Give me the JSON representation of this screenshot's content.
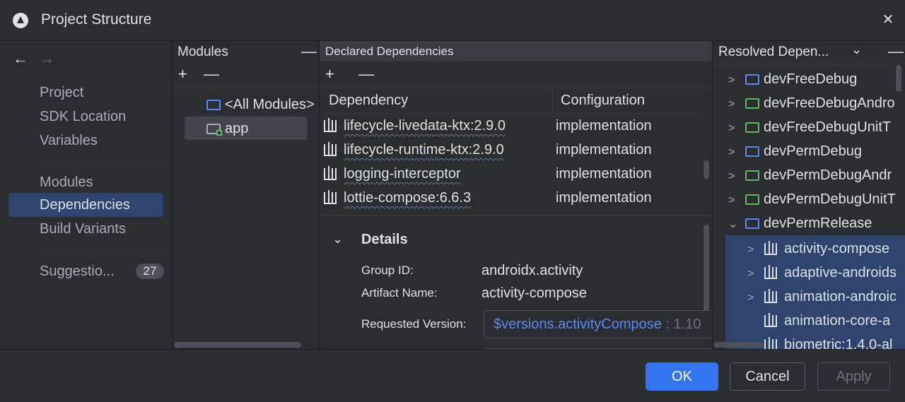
{
  "window": {
    "title": "Project Structure"
  },
  "nav": {
    "items_top": [
      "Project",
      "SDK Location",
      "Variables"
    ],
    "items_mid": [
      "Modules",
      "Dependencies",
      "Build Variants"
    ],
    "selected": "Dependencies",
    "suggestions_label": "Suggestio...",
    "suggestions_count": "27"
  },
  "modules": {
    "header": "Modules",
    "items": [
      "<All Modules>",
      "app"
    ],
    "selected": "app"
  },
  "declared": {
    "header": "Declared Dependencies",
    "col_dependency": "Dependency",
    "col_configuration": "Configuration",
    "rows": [
      {
        "name": "lifecycle-livedata-ktx:2.9.0",
        "config": "implementation"
      },
      {
        "name": "lifecycle-runtime-ktx:2.9.0",
        "config": "implementation"
      },
      {
        "name": "logging-interceptor",
        "config": "implementation"
      },
      {
        "name": "lottie-compose:6.6.3",
        "config": "implementation"
      }
    ]
  },
  "details": {
    "title": "Details",
    "group_id_label": "Group ID:",
    "group_id": "androidx.activity",
    "artifact_label": "Artifact Name:",
    "artifact": "activity-compose",
    "requested_label": "Requested Version:",
    "requested_var": "$versions.activityCompose",
    "requested_value": " : 1.10"
  },
  "resolved": {
    "header": "Resolved Depen...",
    "variants": [
      "devFreeDebug",
      "devFreeDebugAndro",
      "devFreeDebugUnitT",
      "devPermDebug",
      "devPermDebugAndr",
      "devPermDebugUnitT",
      "devPermRelease"
    ],
    "children": [
      "activity-compose",
      "adaptive-androids",
      "animation-androic",
      "animation-core-a",
      "biometric:1.4.0-al"
    ]
  },
  "footer": {
    "ok": "OK",
    "cancel": "Cancel",
    "apply": "Apply"
  },
  "colors": {
    "accent": "#3574f0",
    "selection": "#2e436e",
    "link": "#548af7"
  }
}
